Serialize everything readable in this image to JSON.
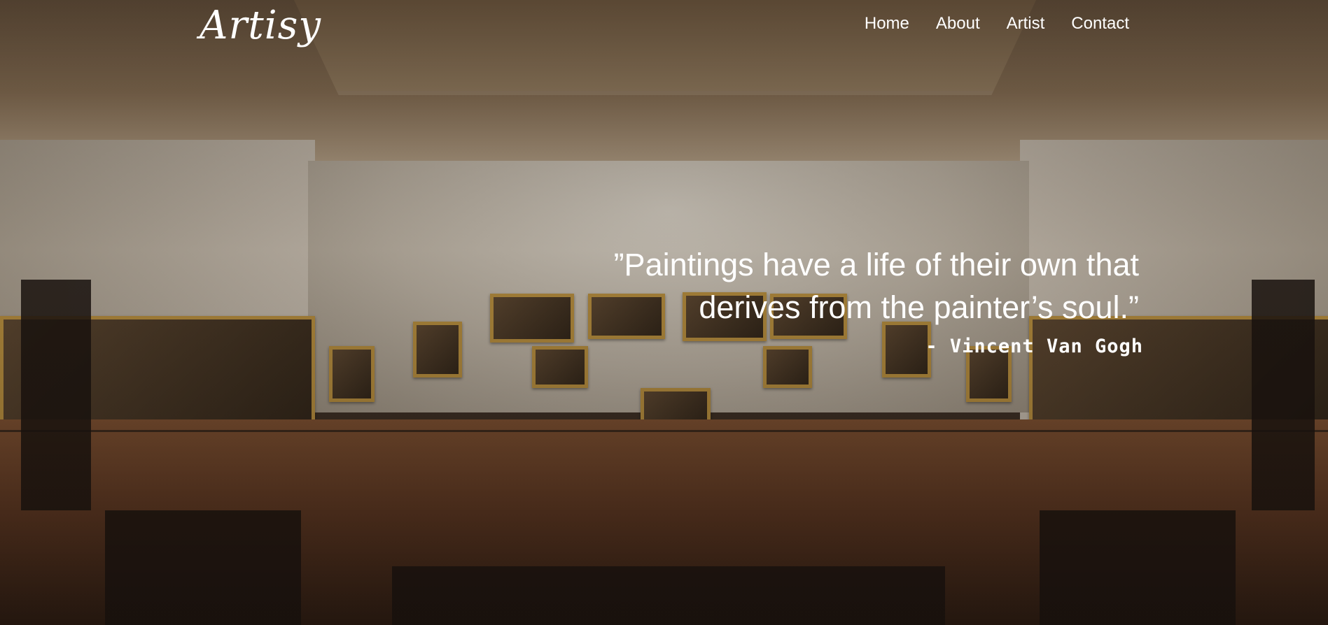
{
  "header": {
    "logo": "Artisy",
    "nav": [
      {
        "label": "Home"
      },
      {
        "label": "About"
      },
      {
        "label": "Artist"
      },
      {
        "label": "Contact"
      }
    ]
  },
  "hero": {
    "quote_line1": "”Paintings have a life of their own that",
    "quote_line2": "derives from the painter’s soul.”",
    "author": "- Vincent Van Gogh"
  }
}
